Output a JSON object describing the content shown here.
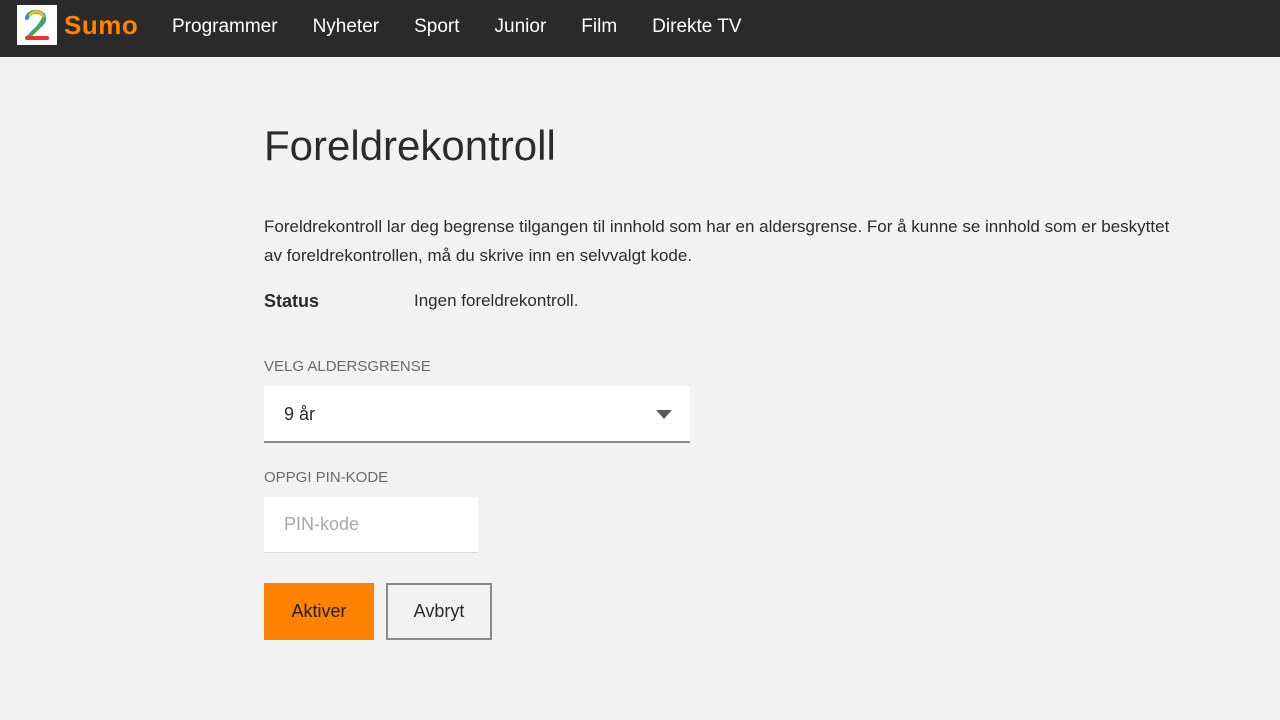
{
  "header": {
    "logo_text": "Sumo",
    "logo_glyph": "2",
    "nav": [
      {
        "label": "Programmer"
      },
      {
        "label": "Nyheter"
      },
      {
        "label": "Sport"
      },
      {
        "label": "Junior"
      },
      {
        "label": "Film"
      },
      {
        "label": "Direkte TV"
      }
    ],
    "colors": {
      "bar": "#2a2a2a",
      "brand": "#ff8200"
    }
  },
  "main": {
    "title": "Foreldrekontroll",
    "intro": "Foreldrekontroll lar deg begrense tilgangen til innhold som har en aldersgrense. For å kunne se innhold som er beskyttet av foreldrekontrollen, må du skrive inn en selvvalgt kode.",
    "status_label": "Status",
    "status_value": "Ingen foreldrekontroll.",
    "age_label": "VELG ALDERSGRENSE",
    "age_selected": "9 år",
    "pin_label": "OPPGI PIN-KODE",
    "pin_placeholder": "PIN-kode",
    "pin_value": "",
    "activate_label": "Aktiver",
    "cancel_label": "Avbryt"
  }
}
